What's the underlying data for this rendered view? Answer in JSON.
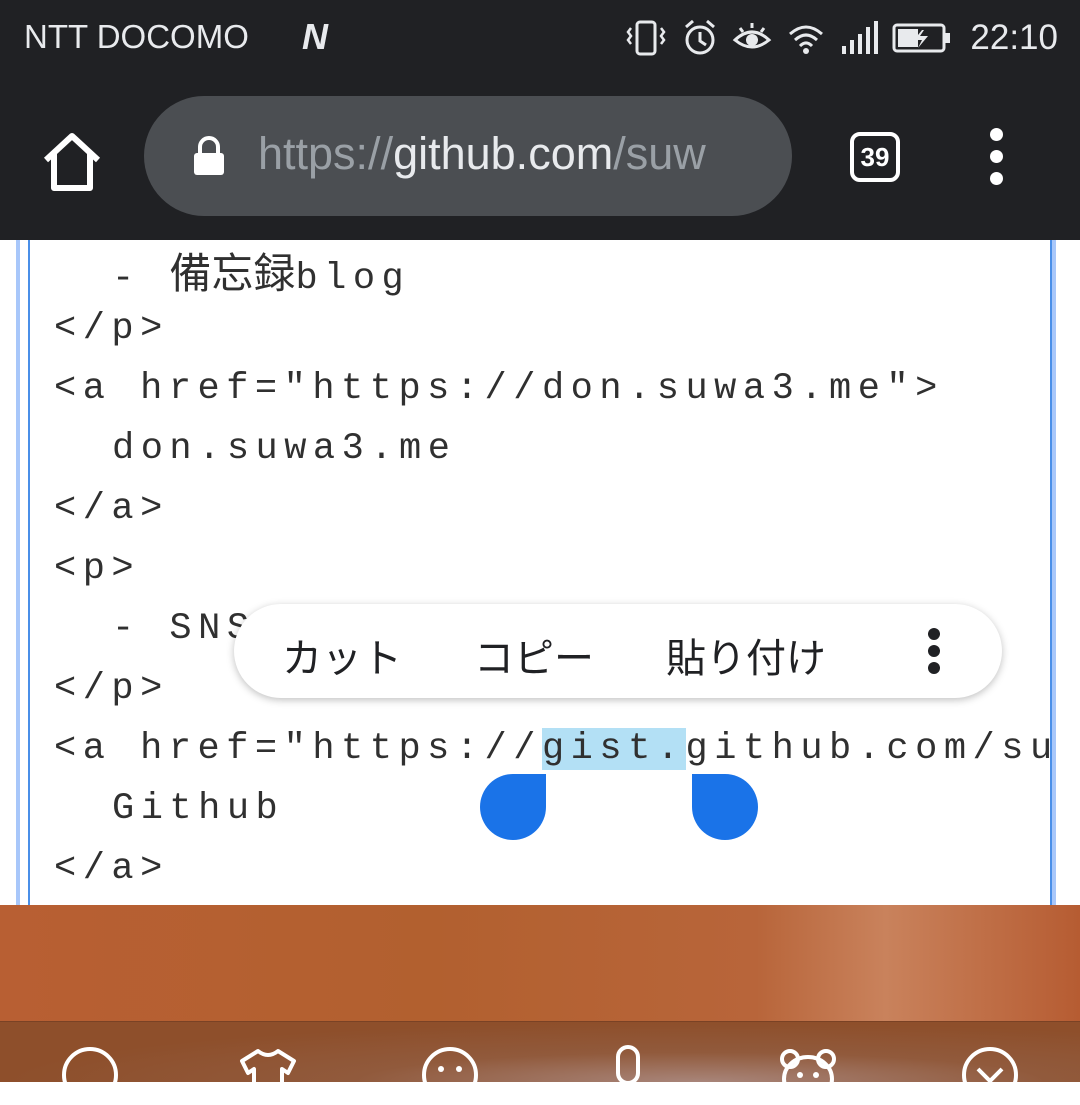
{
  "status_bar": {
    "carrier": "NTT DOCOMO",
    "n_badge": "N",
    "time": "22:10",
    "icons": [
      "vibrate-icon",
      "alarm-icon",
      "eye-comfort-icon",
      "wifi-icon",
      "signal-icon",
      "battery-charging-icon"
    ]
  },
  "toolbar": {
    "url_scheme": "https://",
    "url_host": "github.com",
    "url_rest": "/suw",
    "tab_count": "39"
  },
  "editor": {
    "lines": [
      {
        "prefix": "- ",
        "jp": "備忘録",
        "suffix": "blog"
      },
      {
        "text": "</p>"
      },
      {
        "text": "<a href=\"https://don.suwa3.me\">"
      },
      {
        "text": "don.suwa3.me"
      },
      {
        "text": "</a>"
      },
      {
        "text": "<p>"
      },
      {
        "text": "- SNS"
      },
      {
        "text": "</p>"
      },
      {
        "before": "<a href=\"https://",
        "selected": "gist.",
        "after": "github.com/su"
      },
      {
        "text": "Github"
      },
      {
        "text": "</a>"
      }
    ]
  },
  "context_menu": {
    "cut": "カット",
    "copy": "コピー",
    "paste": "貼り付け"
  },
  "keyboard_toolbar": {
    "icons": [
      "chat-bubble-icon",
      "shirt-icon",
      "emoji-icon",
      "microphone-icon",
      "bear-icon",
      "collapse-icon"
    ]
  },
  "colors": {
    "chrome_dark": "#202124",
    "omnibox": "#4b4e52",
    "selection": "#b3e0f5",
    "handle": "#1a73e8",
    "keyboard_bg": "#b2602f"
  }
}
